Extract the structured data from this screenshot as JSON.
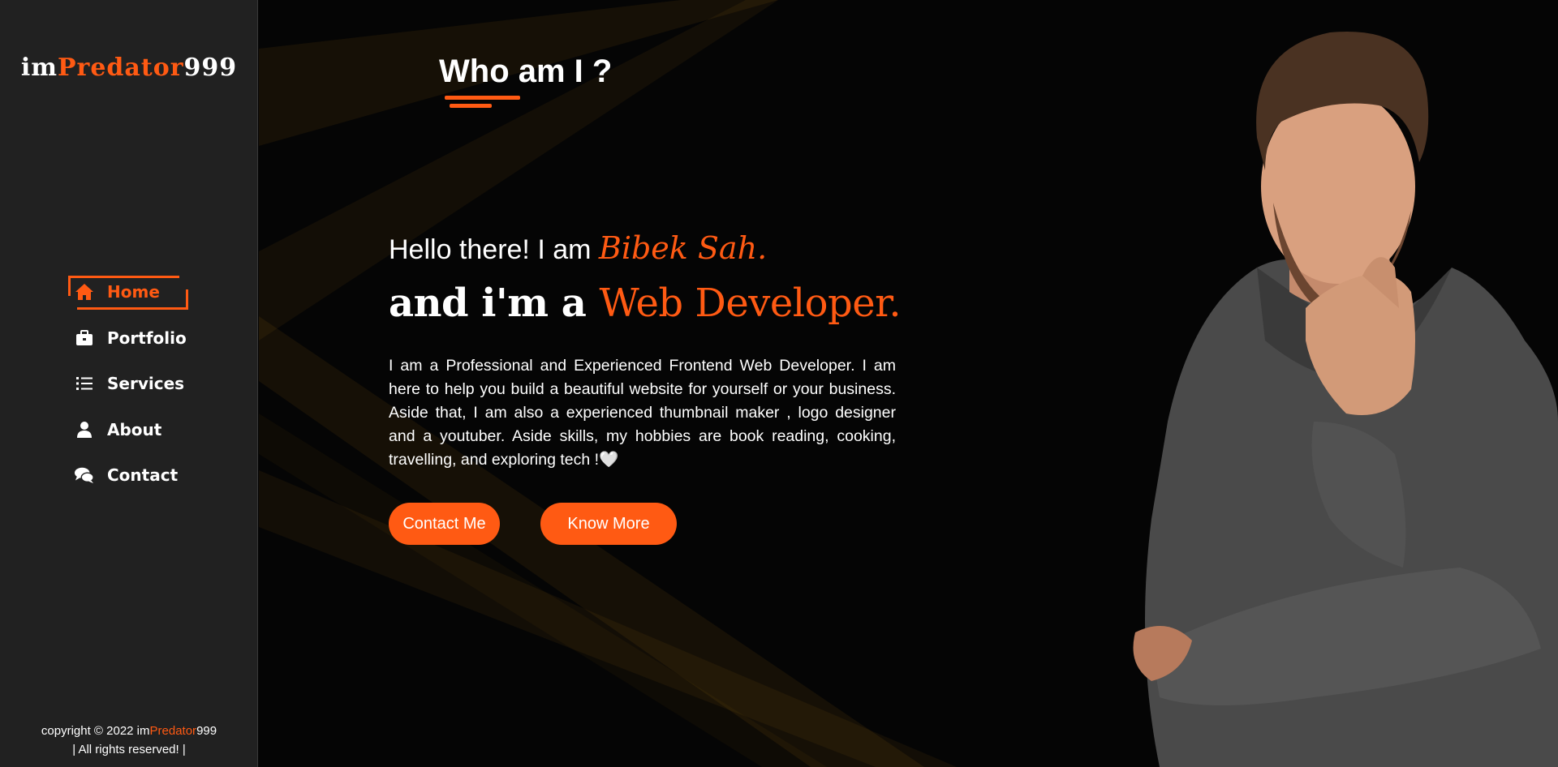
{
  "sidebar": {
    "logo": {
      "prefix": "im",
      "accent": "Predator",
      "suffix": "999"
    },
    "nav": [
      {
        "label": "Home",
        "icon": "home-icon",
        "active": true
      },
      {
        "label": "Portfolio",
        "icon": "briefcase-icon",
        "active": false
      },
      {
        "label": "Services",
        "icon": "list-icon",
        "active": false
      },
      {
        "label": "About",
        "icon": "user-icon",
        "active": false
      },
      {
        "label": "Contact",
        "icon": "chat-icon",
        "active": false
      }
    ],
    "copyright": {
      "prefix": "copyright © 2022 im",
      "accent": "Predator",
      "suffix": "999",
      "line2": "| All rights reserved! |"
    }
  },
  "main": {
    "section_title": "Who am I ?",
    "greeting": "Hello there! I am",
    "name": "Bibek Sah.",
    "role_prefix": "and i'm a",
    "role": "Web Developer.",
    "description": "I am a Professional and Experienced Frontend Web Developer. I am here to help you build a beautiful website for yourself or your business. Aside that, I am also a experienced thumbnail maker , logo designer and a youtuber. Aside skills, my hobbies are book reading, cooking, travelling, and exploring tech !🤍",
    "buttons": {
      "contact": "Contact Me",
      "more": "Know More"
    }
  },
  "colors": {
    "accent": "#ff5a13",
    "sidebar_bg": "#212121",
    "main_bg": "#050505",
    "text": "#ffffff"
  },
  "icons": [
    "home-icon",
    "briefcase-icon",
    "list-icon",
    "user-icon",
    "chat-icon"
  ]
}
